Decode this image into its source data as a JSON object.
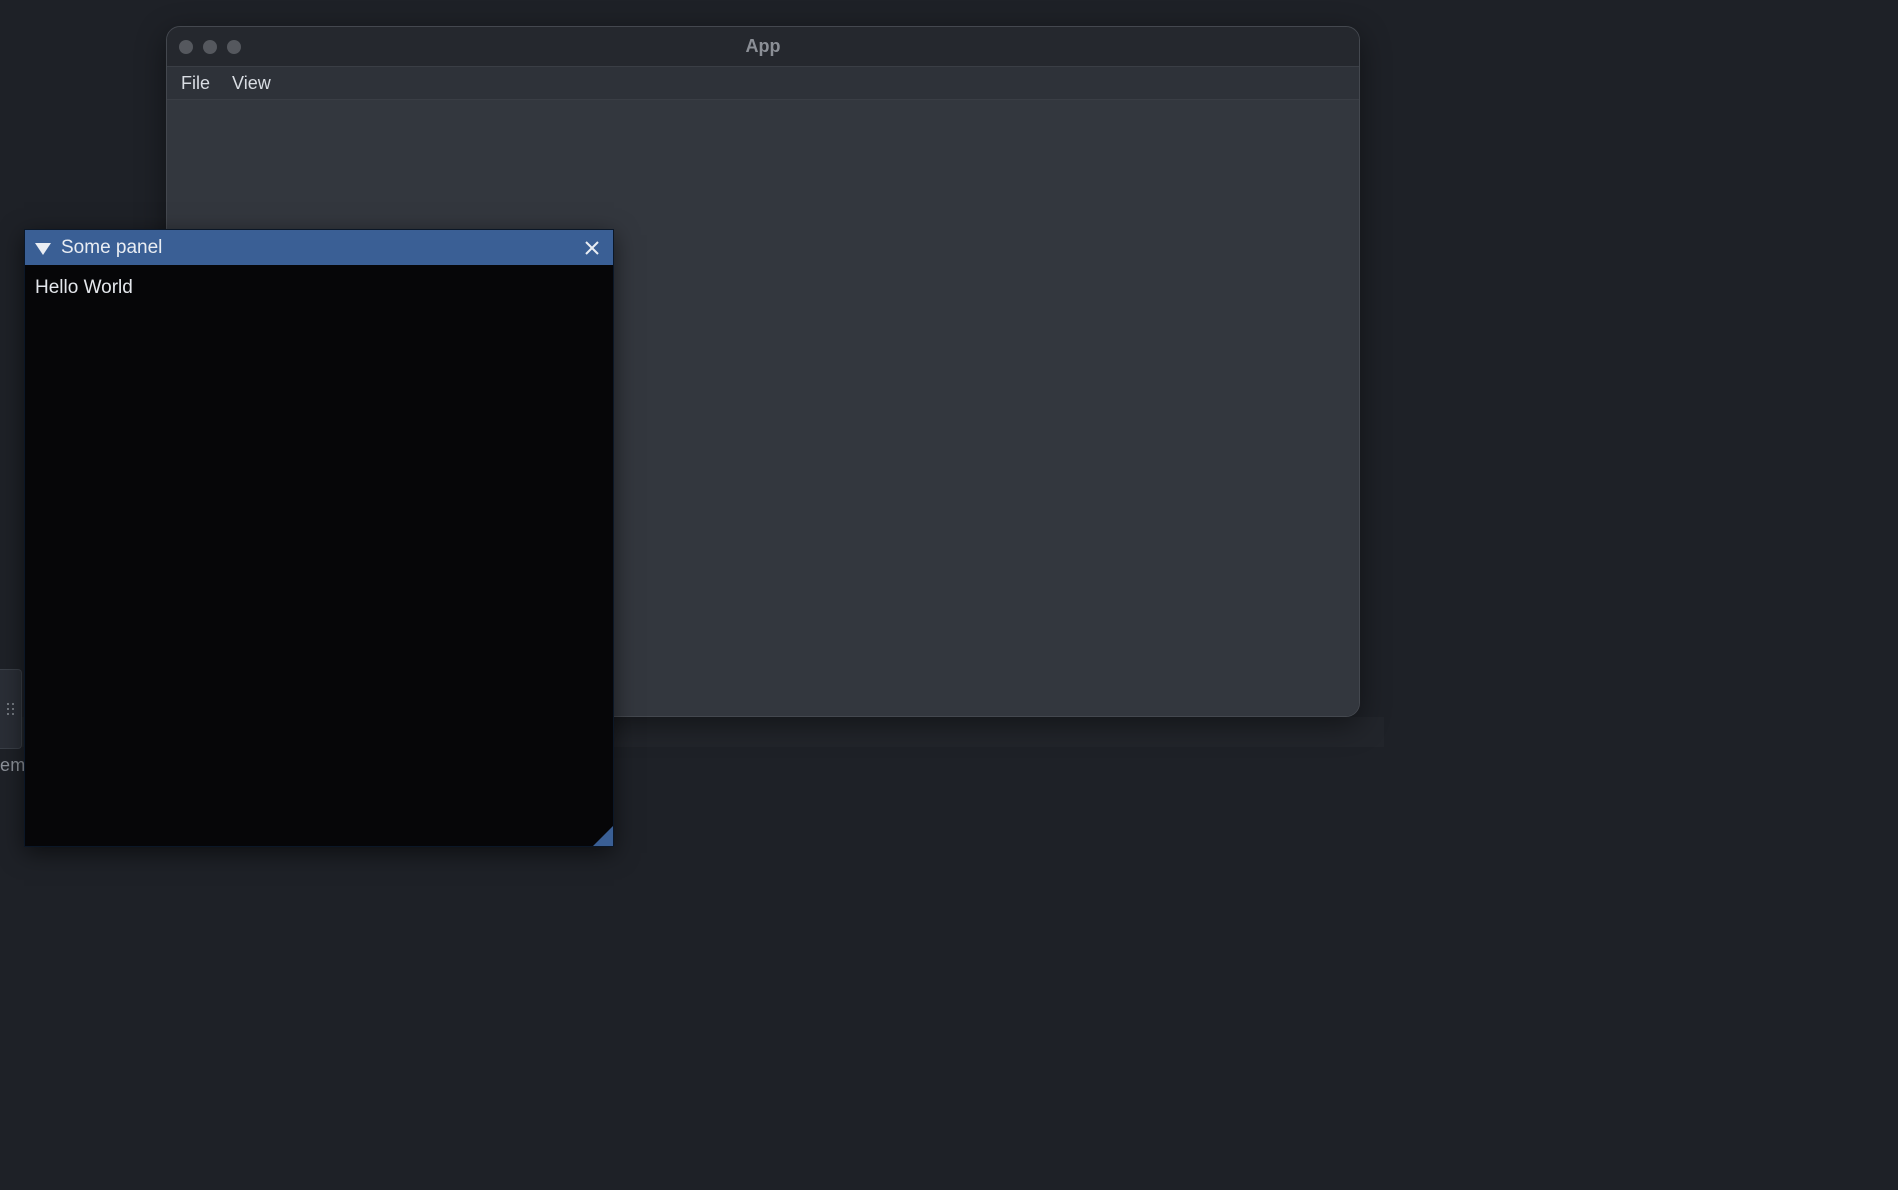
{
  "window": {
    "title": "App",
    "menubar": {
      "items": [
        {
          "label": "File"
        },
        {
          "label": "View"
        }
      ]
    }
  },
  "panel": {
    "title": "Some panel",
    "content": "Hello World"
  },
  "left_strip": {
    "label_fragment": "em"
  },
  "colors": {
    "panel_header": "#3a5f95",
    "panel_bg": "#060608",
    "window_bg": "#33373e",
    "desktop_bg": "#1e2127"
  }
}
